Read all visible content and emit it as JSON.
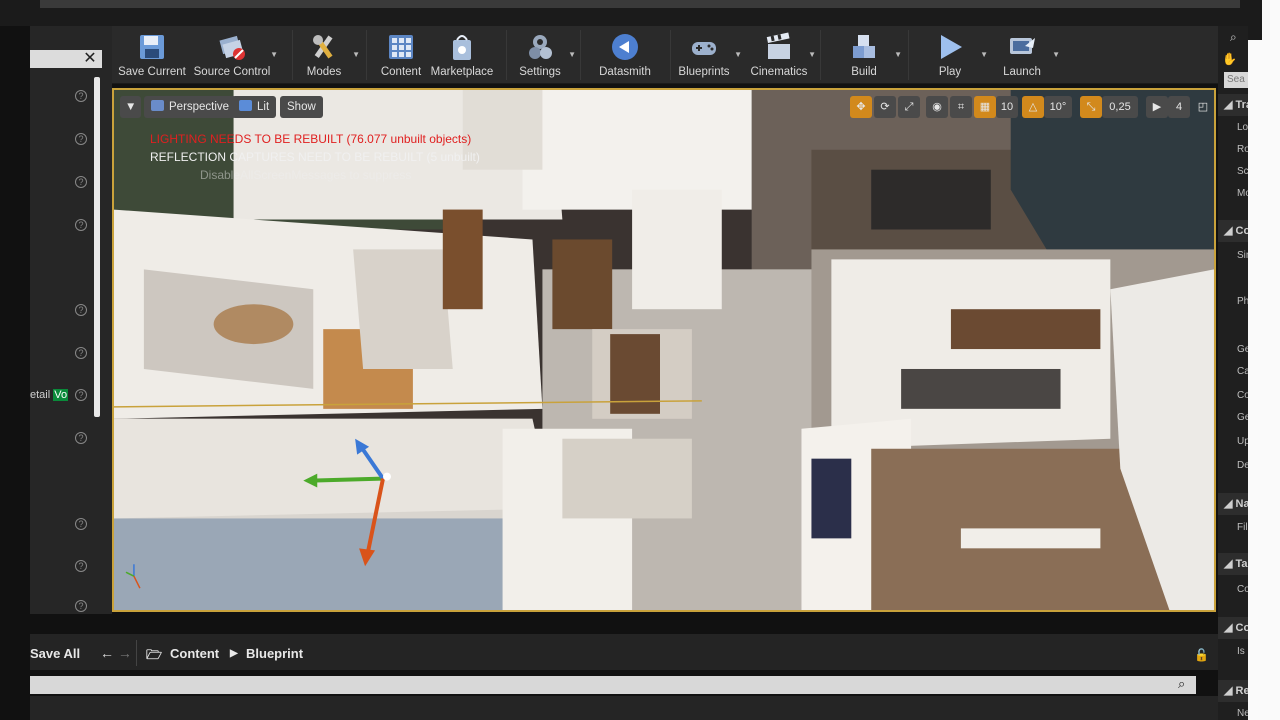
{
  "toolbar": {
    "items": [
      {
        "label": "Save Current",
        "icon": "save-disk-icon"
      },
      {
        "label": "Source Control",
        "icon": "source-control-icon"
      },
      {
        "label": "Modes",
        "icon": "modes-tools-icon"
      },
      {
        "label": "Content",
        "icon": "content-grid-icon"
      },
      {
        "label": "Marketplace",
        "icon": "marketplace-bag-icon"
      },
      {
        "label": "Settings",
        "icon": "settings-gears-icon"
      },
      {
        "label": "Datasmith",
        "icon": "datasmith-icon"
      },
      {
        "label": "Blueprints",
        "icon": "blueprints-gamepad-icon"
      },
      {
        "label": "Cinematics",
        "icon": "clapperboard-icon"
      },
      {
        "label": "Build",
        "icon": "build-blocks-icon"
      },
      {
        "label": "Play",
        "icon": "play-icon"
      },
      {
        "label": "Launch",
        "icon": "launch-icon"
      }
    ]
  },
  "viewport": {
    "perspective_label": "Perspective",
    "lit_label": "Lit",
    "show_label": "Show",
    "grid_snap_value": "10",
    "rotation_snap_value": "10°",
    "scale_snap_value": "0,25",
    "camera_speed_value": "4",
    "warnings": [
      "LIGHTING NEEDS TO BE REBUILT (76.077 unbuilt objects)",
      "REFLECTION CAPTURES NEED TO BE REBUILT (5 unbuilt)",
      "DisableAllScreenMessages to suppress"
    ],
    "axis_labels": {
      "x": "X",
      "y": "Y",
      "z": "Z"
    },
    "accent_color": "#c9a23b"
  },
  "left_panel": {
    "detail_row_prefix": "etail ",
    "detail_row_highlight": "Vo"
  },
  "right_panel": {
    "search_placeholder": "Sea",
    "sections": [
      {
        "label": "Tra",
        "items": [
          "Loc",
          "Ro",
          "Sc",
          "Mo"
        ]
      },
      {
        "label": "Co",
        "items": [
          "Sin",
          "Ph",
          "Ge",
          "Ca",
          "Co",
          "Ge",
          "Up",
          "De"
        ]
      },
      {
        "label": "Na",
        "items": [
          "Fill"
        ]
      },
      {
        "label": "Ta",
        "items": [
          "Co"
        ]
      },
      {
        "label": "Co",
        "items": [
          "Is I"
        ]
      },
      {
        "label": "Re",
        "items": [
          "Ne"
        ]
      }
    ]
  },
  "content_browser": {
    "save_all_label": "Save All",
    "breadcrumb": [
      "Content",
      "Blueprint"
    ]
  }
}
